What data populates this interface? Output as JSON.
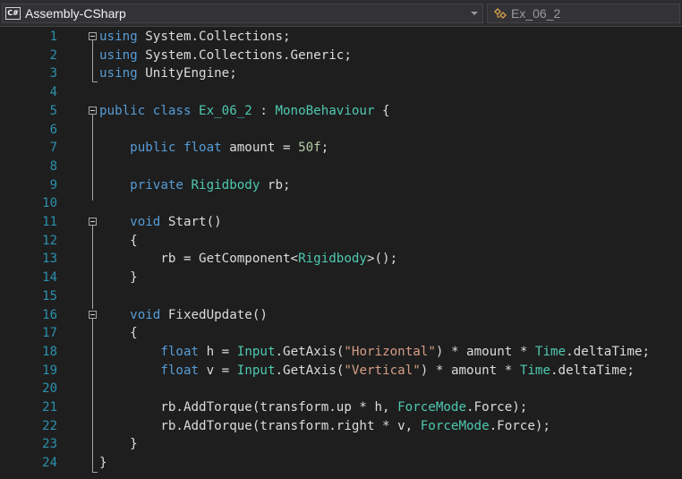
{
  "toolbar": {
    "project": "Assembly-CSharp",
    "project_icon": "C#",
    "member": "Ex_06_2"
  },
  "editor": {
    "lines": [
      {
        "n": "1",
        "tokens": [
          [
            "kw",
            "using"
          ],
          [
            "tx",
            " System.Collections;"
          ]
        ]
      },
      {
        "n": "2",
        "tokens": [
          [
            "kw",
            "using"
          ],
          [
            "tx",
            " System.Collections.Generic;"
          ]
        ]
      },
      {
        "n": "3",
        "tokens": [
          [
            "kw",
            "using"
          ],
          [
            "tx",
            " UnityEngine;"
          ]
        ]
      },
      {
        "n": "4",
        "tokens": []
      },
      {
        "n": "5",
        "tokens": [
          [
            "kw",
            "public class "
          ],
          [
            "ty",
            "Ex_06_2"
          ],
          [
            "tx",
            " : "
          ],
          [
            "ty",
            "MonoBehaviour"
          ],
          [
            "tx",
            " {"
          ]
        ]
      },
      {
        "n": "6",
        "tokens": []
      },
      {
        "n": "7",
        "tokens": [
          [
            "tx",
            "    "
          ],
          [
            "kw",
            "public float"
          ],
          [
            "tx",
            " amount = "
          ],
          [
            "nm",
            "50f"
          ],
          [
            "tx",
            ";"
          ]
        ]
      },
      {
        "n": "8",
        "tokens": []
      },
      {
        "n": "9",
        "tokens": [
          [
            "tx",
            "    "
          ],
          [
            "kw",
            "private "
          ],
          [
            "ty",
            "Rigidbody"
          ],
          [
            "tx",
            " rb;"
          ]
        ]
      },
      {
        "n": "10",
        "tokens": []
      },
      {
        "n": "11",
        "tokens": [
          [
            "tx",
            "    "
          ],
          [
            "kw",
            "void"
          ],
          [
            "tx",
            " Start()"
          ]
        ]
      },
      {
        "n": "12",
        "tokens": [
          [
            "tx",
            "    {"
          ]
        ]
      },
      {
        "n": "13",
        "tokens": [
          [
            "tx",
            "        rb = GetComponent<"
          ],
          [
            "ty",
            "Rigidbody"
          ],
          [
            "tx",
            ">();"
          ]
        ]
      },
      {
        "n": "14",
        "tokens": [
          [
            "tx",
            "    }"
          ]
        ]
      },
      {
        "n": "15",
        "tokens": []
      },
      {
        "n": "16",
        "tokens": [
          [
            "tx",
            "    "
          ],
          [
            "kw",
            "void"
          ],
          [
            "tx",
            " FixedUpdate()"
          ]
        ]
      },
      {
        "n": "17",
        "tokens": [
          [
            "tx",
            "    {"
          ]
        ]
      },
      {
        "n": "18",
        "tokens": [
          [
            "tx",
            "        "
          ],
          [
            "kw",
            "float"
          ],
          [
            "tx",
            " h = "
          ],
          [
            "ty",
            "Input"
          ],
          [
            "tx",
            ".GetAxis("
          ],
          [
            "st",
            "\"Horizontal\""
          ],
          [
            "tx",
            ") * amount * "
          ],
          [
            "ty",
            "Time"
          ],
          [
            "tx",
            ".deltaTime;"
          ]
        ]
      },
      {
        "n": "19",
        "tokens": [
          [
            "tx",
            "        "
          ],
          [
            "kw",
            "float"
          ],
          [
            "tx",
            " v = "
          ],
          [
            "ty",
            "Input"
          ],
          [
            "tx",
            ".GetAxis("
          ],
          [
            "st",
            "\"Vertical\""
          ],
          [
            "tx",
            ") * amount * "
          ],
          [
            "ty",
            "Time"
          ],
          [
            "tx",
            ".deltaTime;"
          ]
        ]
      },
      {
        "n": "20",
        "tokens": []
      },
      {
        "n": "21",
        "tokens": [
          [
            "tx",
            "        rb.AddTorque(transform.up * h, "
          ],
          [
            "ty",
            "ForceMode"
          ],
          [
            "tx",
            ".Force);"
          ]
        ]
      },
      {
        "n": "22",
        "tokens": [
          [
            "tx",
            "        rb.AddTorque(transform.right * v, "
          ],
          [
            "ty",
            "ForceMode"
          ],
          [
            "tx",
            ".Force);"
          ]
        ]
      },
      {
        "n": "23",
        "tokens": [
          [
            "tx",
            "    }"
          ]
        ]
      },
      {
        "n": "24",
        "tokens": [
          [
            "tx",
            "}"
          ]
        ]
      }
    ]
  },
  "colors": {
    "keyword": "#569cd6",
    "type": "#4ec9b0",
    "string": "#d69d85",
    "number": "#b5cea8",
    "text": "#dcdcdc",
    "line_number": "#2b91af",
    "background": "#1e1e1e"
  },
  "icons": {
    "project": "csharp-project-icon",
    "member": "class-member-icon",
    "fold": "collapse-minus-icon"
  }
}
